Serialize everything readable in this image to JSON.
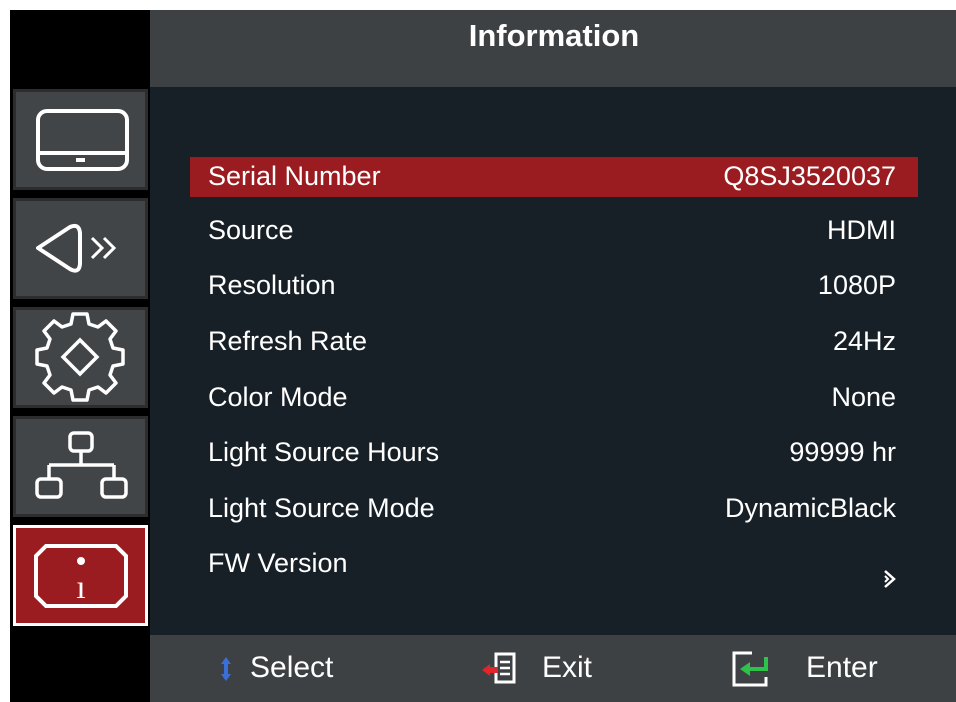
{
  "header": {
    "title": "Information"
  },
  "sidebar": {
    "items": [
      {
        "name": "display",
        "icon": "monitor-icon",
        "active": false
      },
      {
        "name": "audio",
        "icon": "speaker-icon",
        "active": false
      },
      {
        "name": "settings",
        "icon": "gear-icon",
        "active": false
      },
      {
        "name": "network",
        "icon": "network-icon",
        "active": false
      },
      {
        "name": "information",
        "icon": "info-icon",
        "active": true
      }
    ]
  },
  "info": {
    "rows": [
      {
        "label": "Serial Number",
        "value": "Q8SJ3520037",
        "selected": true
      },
      {
        "label": "Source",
        "value": "HDMI"
      },
      {
        "label": "Resolution",
        "value": "1080P"
      },
      {
        "label": "Refresh Rate",
        "value": "24Hz"
      },
      {
        "label": "Color Mode",
        "value": "None"
      },
      {
        "label": "Light Source Hours",
        "value": "99999 hr"
      },
      {
        "label": "Light Source Mode",
        "value": "DynamicBlack"
      },
      {
        "label": "FW Version",
        "value_icon": "chevron-right-icon"
      }
    ]
  },
  "footer": {
    "select": {
      "label": "Select",
      "icon": "up-down-arrows-icon"
    },
    "exit": {
      "label": "Exit",
      "icon": "exit-icon"
    },
    "enter": {
      "label": "Enter",
      "icon": "enter-icon"
    }
  },
  "colors": {
    "accent": "#9b1c20",
    "panel": "#182027",
    "bar": "#3d4143",
    "tile": "#424547"
  }
}
